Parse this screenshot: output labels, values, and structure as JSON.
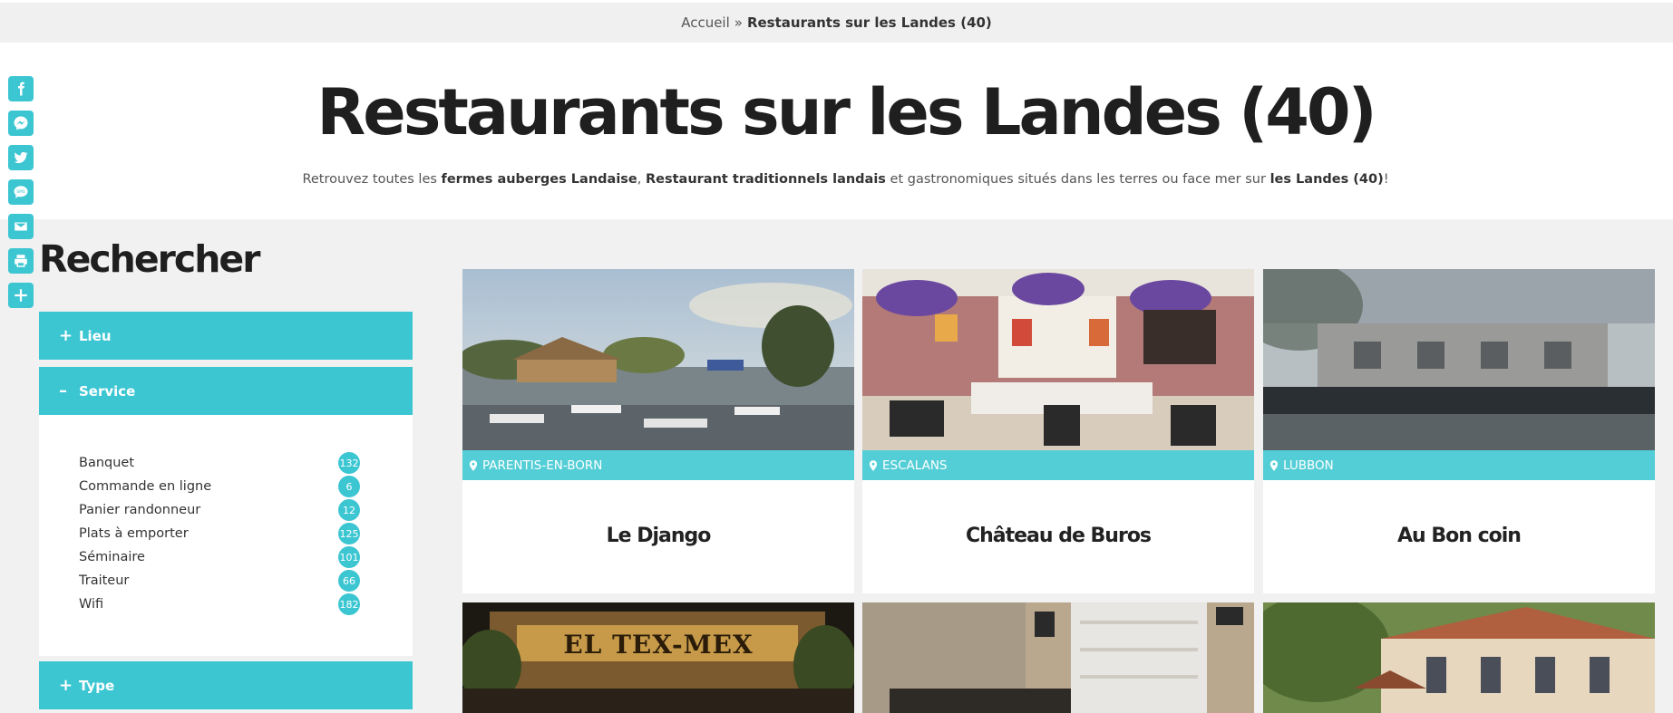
{
  "breadcrumb": {
    "home": "Accueil",
    "separator": "»",
    "current": "Restaurants sur les Landes (40)"
  },
  "hero": {
    "title": "Restaurants sur les Landes (40)",
    "intro_1": "Retrouvez toutes les ",
    "intro_b1": "fermes auberges Landaise",
    "intro_2": ", ",
    "intro_b2": "Restaurant traditionnels landais",
    "intro_3": " et gastronomiques situés dans les terres ou face mer sur ",
    "intro_b3": "les Landes (40)",
    "intro_4": "!"
  },
  "share": [
    "facebook-icon",
    "messenger-icon",
    "twitter-icon",
    "sms-icon",
    "email-icon",
    "print-icon",
    "add-icon"
  ],
  "search": {
    "title": "Rechercher",
    "filters": [
      {
        "label": "Lieu",
        "symbol": "+"
      },
      {
        "label": "Service",
        "symbol": "–"
      },
      {
        "label": "Type",
        "symbol": "+"
      }
    ],
    "services": [
      {
        "label": "Banquet",
        "count": "132"
      },
      {
        "label": "Commande en ligne",
        "count": "6"
      },
      {
        "label": "Panier randonneur",
        "count": "12"
      },
      {
        "label": "Plats à emporter",
        "count": "125"
      },
      {
        "label": "Séminaire",
        "count": "101"
      },
      {
        "label": "Traiteur",
        "count": "66"
      },
      {
        "label": "Wifi",
        "count": "182"
      }
    ]
  },
  "restaurants": [
    {
      "location": "PARENTIS-EN-BORN",
      "name": "Le Django"
    },
    {
      "location": "ESCALANS",
      "name": "Château de Buros"
    },
    {
      "location": "LUBBON",
      "name": "Au Bon coin"
    }
  ],
  "row2_signs": {
    "tex_mex": "EL TEX-MEX"
  },
  "colors": {
    "accent": "#3cc6d2",
    "location_bar": "#54ced6"
  }
}
